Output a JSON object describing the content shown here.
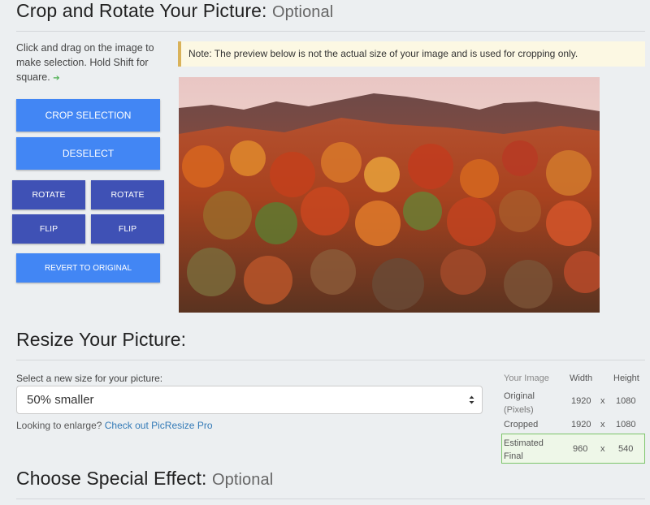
{
  "crop": {
    "title": "Crop and Rotate Your Picture:",
    "optional": "Optional",
    "instructions": "Click and drag on the image to make selection. Hold Shift for square.",
    "arrow": "➔",
    "note": "Note: The preview below is not the actual size of your image and is used for cropping only.",
    "buttons": {
      "crop_selection": "CROP SELECTION",
      "deselect": "DESELECT",
      "rotate_left": "ROTATE",
      "rotate_right": "ROTATE",
      "flip_horizontal": "FLIP",
      "flip_vertical": "FLIP",
      "revert": "REVERT TO ORIGINAL"
    }
  },
  "resize": {
    "title": "Resize Your Picture:",
    "select_label": "Select a new size for your picture:",
    "selected": "50% smaller",
    "enlarge_prefix": "Looking to enlarge?",
    "enlarge_link": "Check out PicResize Pro",
    "table": {
      "headers": [
        "Your Image",
        "Width",
        "Height"
      ],
      "rows": [
        {
          "label_line1": "Original",
          "label_line2": "(Pixels)",
          "width": "1920",
          "x": "x",
          "height": "1080"
        },
        {
          "label_line1": "Cropped",
          "label_line2": "",
          "width": "1920",
          "x": "x",
          "height": "1080"
        },
        {
          "label_line1": "Estimated",
          "label_line2": "Final",
          "width": "960",
          "x": "x",
          "height": "540"
        }
      ]
    }
  },
  "effect": {
    "title": "Choose Special Effect:",
    "optional": "Optional"
  },
  "colors": {
    "button_blue": "#4286f4",
    "button_indigo": "#3f51b5",
    "note_bg": "#fcf8e3",
    "final_highlight": "#eef7e8"
  }
}
